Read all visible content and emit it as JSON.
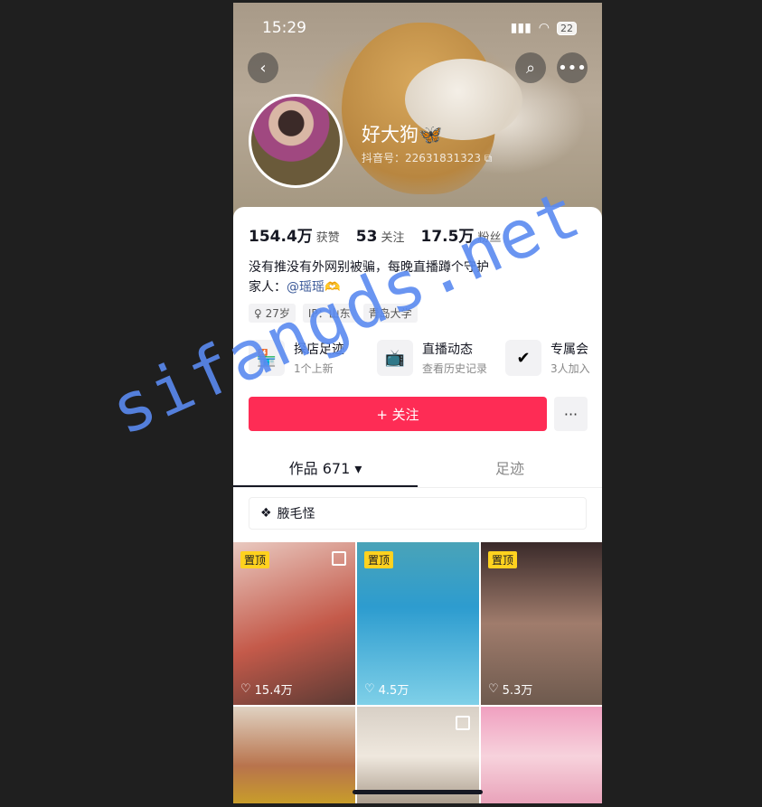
{
  "status": {
    "time": "15:29",
    "signal": "▮▮▮",
    "wifi": "◠",
    "battery": "22"
  },
  "header": {
    "back_icon": "back-icon",
    "search_icon": "search-icon",
    "more_icon": "more-icon"
  },
  "profile": {
    "name": "好大狗🦋",
    "douyin_id": "抖音号：22631831323 ⧉"
  },
  "stats": [
    {
      "value": "154.4万",
      "label": "获赞"
    },
    {
      "value": "53",
      "label": "关注"
    },
    {
      "value": "17.5万",
      "label": "粉丝"
    }
  ],
  "bio": {
    "line1": "没有推没有外网别被骗，每晚直播蹲个守护",
    "line2_prefix": "家人：",
    "mention": "@瑶瑶🫶"
  },
  "tags": [
    "♀ 27岁",
    "IP：山东",
    "青岛大学"
  ],
  "features": [
    {
      "icon": "🏪",
      "title": "探店足迹",
      "sub": "1个上新"
    },
    {
      "icon": "📺",
      "title": "直播动态",
      "sub": "查看历史记录"
    },
    {
      "icon": "✔",
      "title": "专属会",
      "sub": "3人加入"
    }
  ],
  "actions": {
    "follow_label": "+ 关注",
    "more_label": "···"
  },
  "tabs": [
    {
      "label": "作品 671 ▾"
    },
    {
      "label": "足迹"
    }
  ],
  "collection": {
    "label": "腋毛怪",
    "icon": "stack-icon"
  },
  "videos": [
    {
      "pinned": "置顶",
      "likes": "15.4万",
      "bg": "linear-gradient(160deg,#e9c9c0,#c45a4a 55%,#5a3a34)"
    },
    {
      "pinned": "置顶",
      "likes": "4.5万",
      "bg": "linear-gradient(180deg,#4aa3b8,#2d9ccf 40%,#7fd0e8)"
    },
    {
      "pinned": "置顶",
      "likes": "5.3万",
      "bg": "linear-gradient(180deg,#3a2a2a,#a07c6c 50%,#6e5a4e)"
    },
    {
      "pinned": "",
      "likes": "",
      "bg": "linear-gradient(180deg,#e0d2c2,#b8734c 60%,#c9a028)"
    },
    {
      "pinned": "",
      "likes": "",
      "bg": "linear-gradient(180deg,#d8d0c6,#efe8de 50%,#a99a8a)"
    },
    {
      "pinned": "",
      "likes": "",
      "bg": "linear-gradient(180deg,#f0a0c0,#f7d2dc 50%,#e8a0b8)"
    }
  ],
  "watermark": "sifangds.net"
}
